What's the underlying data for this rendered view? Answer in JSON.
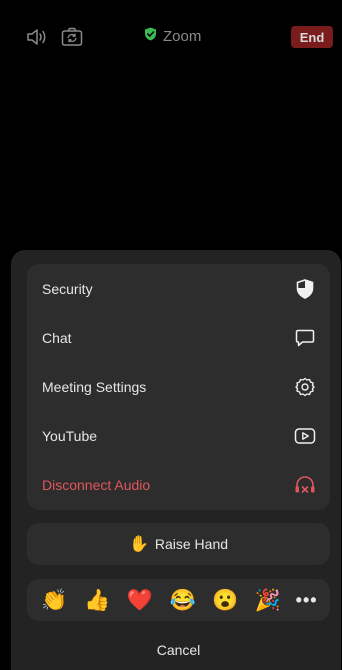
{
  "topbar": {
    "title": "Zoom",
    "end_label": "End",
    "icons": {
      "speaker": "speaker-icon",
      "camera": "camera-switch-icon",
      "shield": "shield-check-icon"
    }
  },
  "menu": {
    "items": [
      {
        "label": "Security",
        "icon": "shield-icon"
      },
      {
        "label": "Chat",
        "icon": "chat-bubble-icon"
      },
      {
        "label": "Meeting Settings",
        "icon": "gear-icon"
      },
      {
        "label": "YouTube",
        "icon": "youtube-play-icon"
      },
      {
        "label": "Disconnect Audio",
        "icon": "headphones-x-icon"
      }
    ]
  },
  "raise_hand": {
    "label": "Raise Hand",
    "icon": "✋"
  },
  "reactions": {
    "items": [
      "👏",
      "👍",
      "❤️",
      "😂",
      "😮",
      "🎉"
    ],
    "more_label": "•••"
  },
  "cancel_label": "Cancel",
  "colors": {
    "background": "#000000",
    "sheet": "#232323",
    "card": "#2d2d2d",
    "danger": "#e0575b",
    "end_button": "#7a1c1c",
    "secure_green": "#3cba54"
  }
}
